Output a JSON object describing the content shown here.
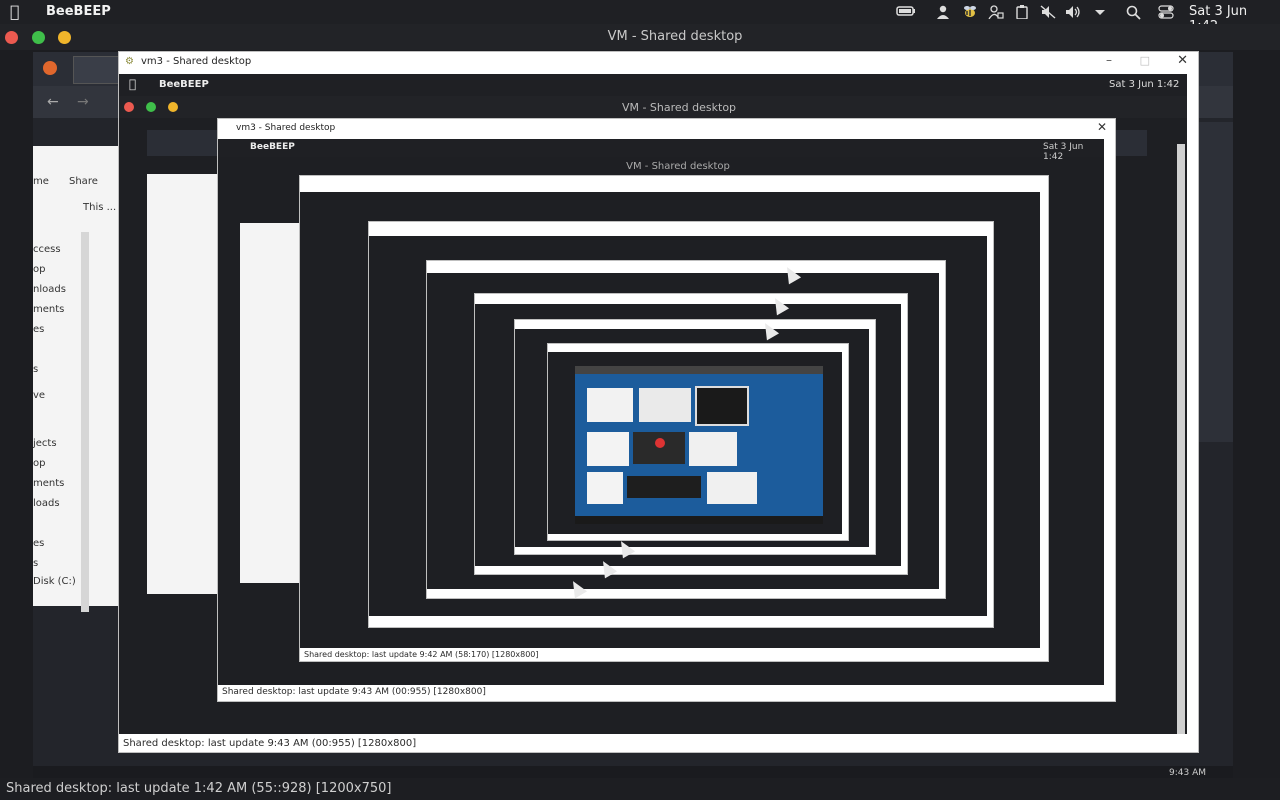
{
  "menubar": {
    "app_name": "BeeBEEP",
    "clock": "Sat 3 Jun 1:42",
    "icons": [
      "apple-icon",
      "battery-icon",
      "user-icon",
      "bee-icon",
      "user-lock-icon",
      "clipboard-icon",
      "mute-icon",
      "volume-icon",
      "chevron-down-icon",
      "search-icon",
      "toggle-icon"
    ]
  },
  "window": {
    "title": "VM - Shared desktop",
    "status": "Shared desktop: last update 1:42 AM (55::928) [1200x750]"
  },
  "nested": {
    "title1": "vm3 - Shared desktop",
    "app_name": "BeeBEEP",
    "inner_title": "VM - Shared desktop",
    "clock": "Sat 3 Jun 1:42",
    "status1": "Shared desktop: last update 9:43 AM (00:955) [1280x800]",
    "status2": "Shared desktop: last update 9:42 AM (58:170) [1280x800]",
    "taskbar_time": "9:43 AM"
  },
  "explorer": {
    "ribbon": [
      "me",
      "Share"
    ],
    "path": "This ...",
    "items": [
      "ccess",
      "op",
      "nloads",
      "ments",
      "es",
      "s",
      "ve",
      "jects",
      "op",
      "ments",
      "loads",
      "es",
      "s",
      "Disk (C:)"
    ]
  }
}
